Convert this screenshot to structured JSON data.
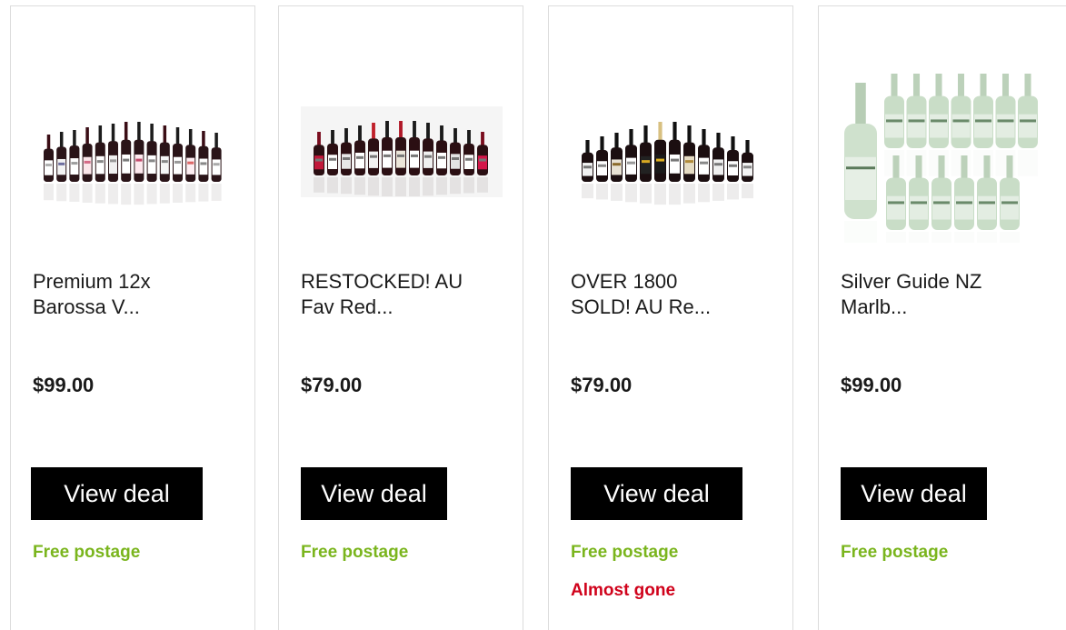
{
  "deals": [
    {
      "image_alt": "12 bottles of Barossa Valley red wine",
      "title": "Premium 12x\nBarossa V...",
      "price": "$99.00",
      "cta_label": "View deal",
      "postage": "Free postage",
      "scarcity": ""
    },
    {
      "image_alt": "12 bottles of assorted red wine",
      "title": "RESTOCKED! AU\nFav Red...",
      "price": "$79.00",
      "cta_label": "View deal",
      "postage": "Free postage",
      "scarcity": ""
    },
    {
      "image_alt": "12 bottles of assorted red wine with yellow label",
      "title": "OVER 1800\nSOLD! AU Re...",
      "price": "$79.00",
      "cta_label": "View deal",
      "postage": "Free postage",
      "scarcity": "Almost gone"
    },
    {
      "image_alt": "12 bottles of Silver Guide NZ white wine",
      "title": "Silver Guide NZ\nMarlb...",
      "price": "$99.00",
      "cta_label": "View deal",
      "postage": "Free postage",
      "scarcity": ""
    }
  ],
  "colors": {
    "postage": "#7ab51d",
    "scarcity": "#d0021b",
    "button_bg": "#000000",
    "button_text": "#ffffff",
    "card_border": "#dcdcdc"
  }
}
